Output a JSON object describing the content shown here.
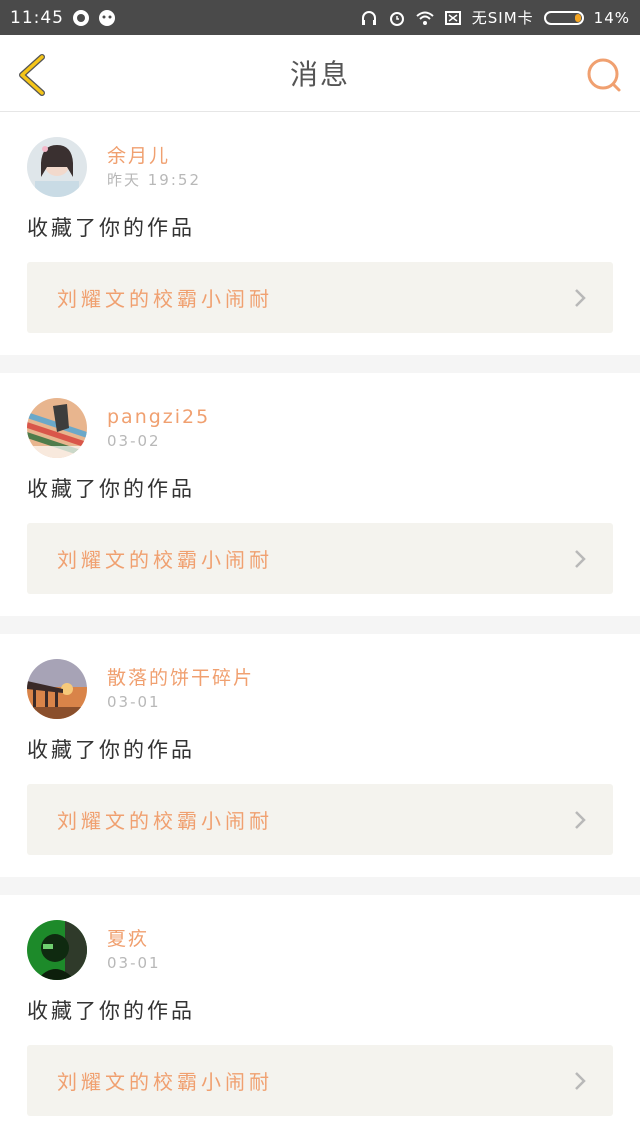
{
  "status_bar": {
    "time": "11:45",
    "carrier": "无SIM卡",
    "battery": "14%"
  },
  "nav": {
    "title": "消息",
    "back_icon": "chevron-left-icon",
    "search_icon": "search-icon"
  },
  "colors": {
    "accent": "#f0a070",
    "back_icon": "#f5c518",
    "card_bg": "#ffffff",
    "link_bg": "#f4f3ee"
  },
  "messages": [
    {
      "user": "余月儿",
      "time": "昨天 19:52",
      "action": "收藏了你的作品",
      "work": "刘耀文的校霸小闹耐"
    },
    {
      "user": "pangzi25",
      "time": "03-02",
      "action": "收藏了你的作品",
      "work": "刘耀文的校霸小闹耐"
    },
    {
      "user": "散落的饼干碎片",
      "time": "03-01",
      "action": "收藏了你的作品",
      "work": "刘耀文的校霸小闹耐"
    },
    {
      "user": "夏疚",
      "time": "03-01",
      "action": "收藏了你的作品",
      "work": "刘耀文的校霸小闹耐"
    }
  ]
}
